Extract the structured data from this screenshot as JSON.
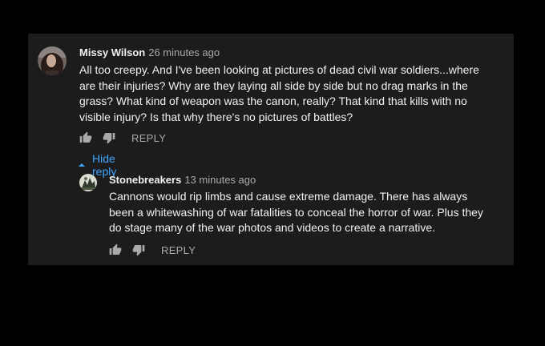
{
  "comments": {
    "top": {
      "author": "Missy Wilson",
      "time": "26 minutes ago",
      "text": "All too creepy. And I've been looking at pictures of dead civil war soldiers...where are their injuries? Why are they laying all side by side but no drag marks in the grass? What kind of weapon was the canon, really? That kind that kills with no visible injury? Is that why there's no pictures of battles?",
      "reply_label": "REPLY",
      "hide_reply_label": "Hide reply"
    },
    "reply": {
      "author": "Stonebreakers",
      "time": "13 minutes ago",
      "text": "Cannons would rip limbs and cause extreme damage. There has always been a whitewashing of war fatalities to conceal the horror of war. Plus they do stage many of the war photos and videos to create a narrative.",
      "reply_label": "REPLY"
    }
  },
  "colors": {
    "background": "#000000",
    "panel": "#1c1c1c",
    "text": "#f1f1f1",
    "secondary_text": "#aaaaaa",
    "link": "#3ea6ff"
  },
  "icons": {
    "like": "thumb-up-icon",
    "dislike": "thumb-down-icon",
    "hide": "caret-up-icon"
  }
}
